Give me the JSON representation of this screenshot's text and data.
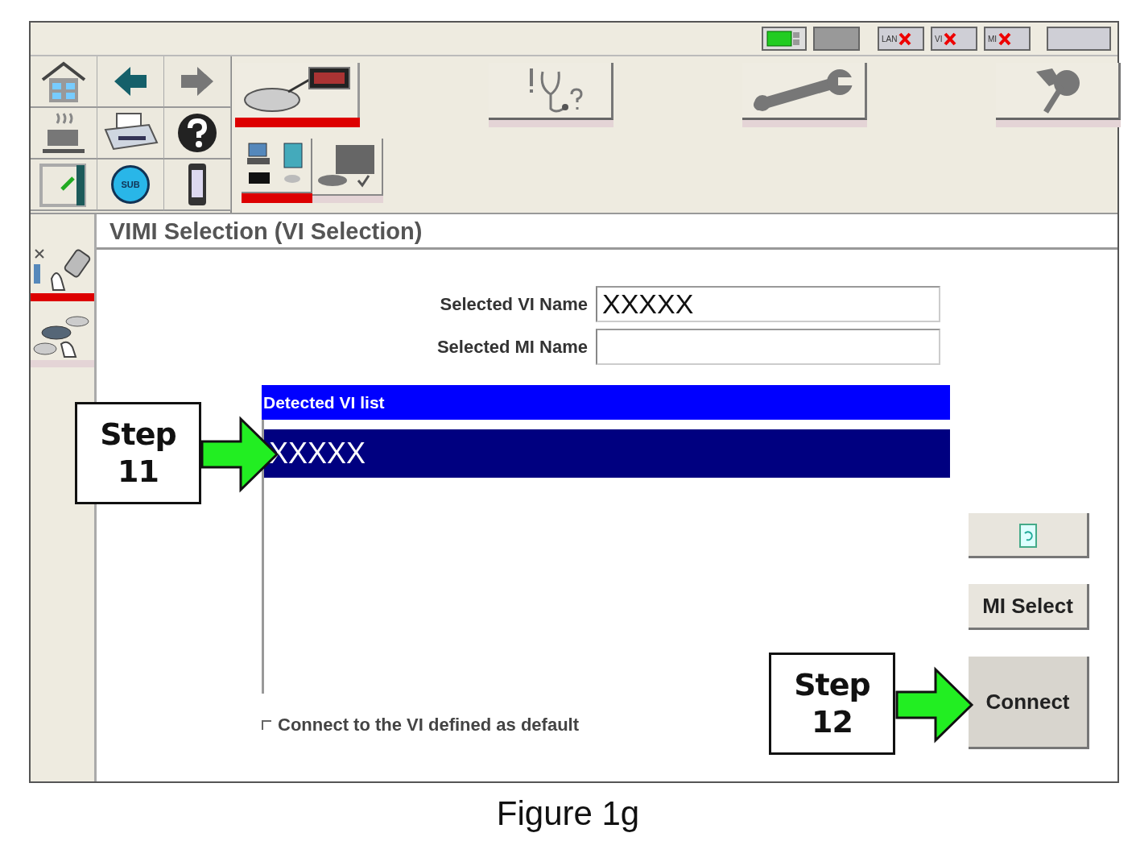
{
  "status_bar": {
    "indicators": [
      {
        "kind": "pc"
      },
      {
        "kind": "blank"
      },
      {
        "kind": "link",
        "label": "LAN",
        "error": true
      },
      {
        "kind": "link",
        "label": "VI",
        "error": true
      },
      {
        "kind": "link",
        "label": "MI",
        "error": true
      },
      {
        "kind": "wide"
      }
    ]
  },
  "quick_buttons": {
    "sub_label": "SUB"
  },
  "main_tabs": [
    {
      "selected": true
    },
    {
      "selected": false
    },
    {
      "selected": false
    },
    {
      "selected": false
    }
  ],
  "sub_tabs": [
    {
      "selected": true
    },
    {
      "selected": false
    }
  ],
  "side_tabs": [
    {
      "selected": true
    },
    {
      "selected": false
    }
  ],
  "panel": {
    "title": "VIMI Selection (VI Selection)",
    "fields": [
      {
        "label": "Selected VI Name",
        "value": "XXXXX"
      },
      {
        "label": "Selected MI Name"
      }
    ],
    "list": {
      "header": "Detected VI list",
      "items": [
        {
          "text": "XXXXX",
          "selected": true
        }
      ]
    },
    "checkbox": {
      "label": "Connect to the VI defined as default",
      "checked": false
    },
    "buttons": [
      {
        "kind": "icon"
      },
      {
        "kind": "text",
        "label": "MI Select"
      },
      {
        "kind": "text",
        "label": "Connect"
      }
    ]
  },
  "callouts": [
    {
      "text": "Step 11"
    },
    {
      "text": "Step 12"
    }
  ],
  "caption": "Figure 1g"
}
